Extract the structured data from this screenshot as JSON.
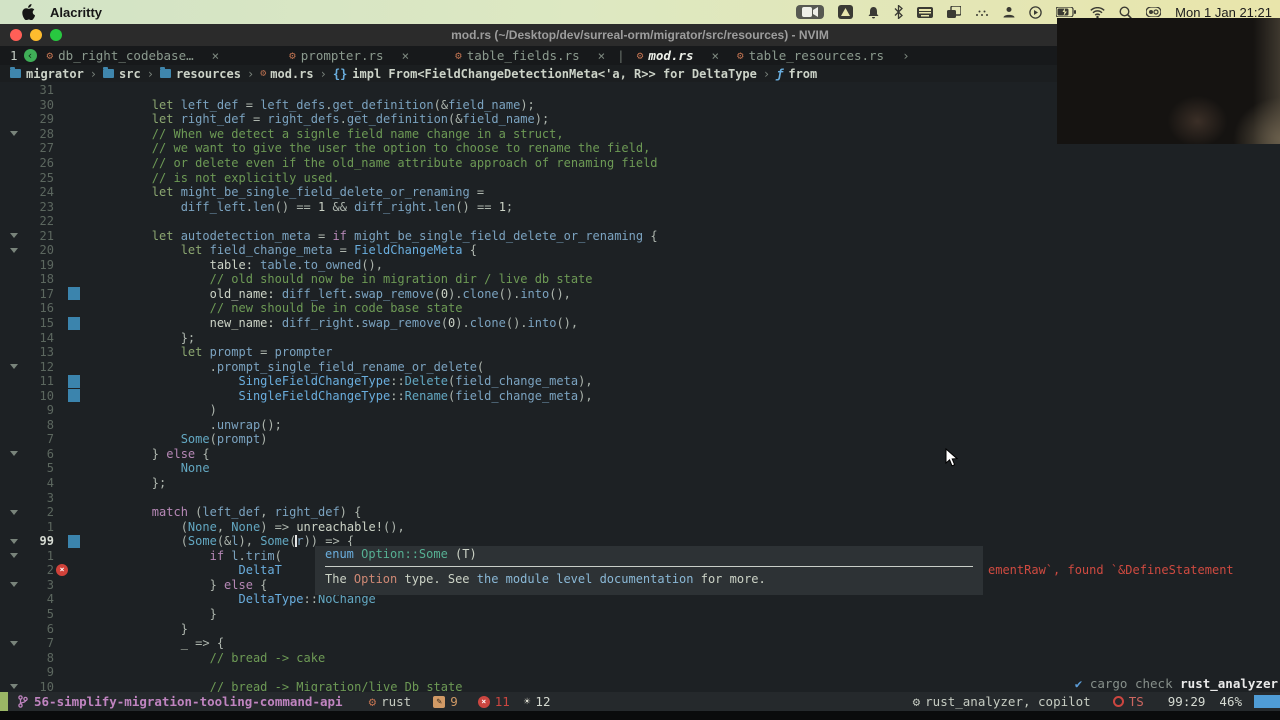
{
  "colors": {
    "accent_blue": "#4f9cd6",
    "error_red": "#cc4640",
    "warn_orange": "#d19a66",
    "branch_purple": "#c084c0",
    "comment_green": "#6d9a55",
    "change_mark_blue": "#3b84ad",
    "mode_green": "#9ab665",
    "traffic_red": "#ff5f57",
    "traffic_yellow": "#febc2e",
    "traffic_green": "#28c840"
  },
  "menubar": {
    "app_name": "Alacritty",
    "clock": "Mon 1 Jan 21:21"
  },
  "window": {
    "title": "mod.rs (~/Desktop/dev/surreal-orm/migrator/src/resources) - NVIM"
  },
  "tabs": {
    "count_label": "1",
    "back_glyph": "‹",
    "items": [
      {
        "label": "db_right_codebase…",
        "close": "×",
        "active": false
      },
      {
        "label": "prompter.rs",
        "close": "×",
        "active": false
      },
      {
        "label": "table_fields.rs",
        "close": "×",
        "active": false
      },
      {
        "label": "mod.rs",
        "close": "×",
        "active": true
      },
      {
        "label": "table_resources.rs",
        "close": "›",
        "active": false
      }
    ]
  },
  "breadcrumb": {
    "separator": "›",
    "segments": [
      {
        "icon": "folder",
        "label": "migrator"
      },
      {
        "icon": "folder",
        "label": "src"
      },
      {
        "icon": "folder",
        "label": "resources"
      },
      {
        "icon": "rust",
        "label": "mod.rs"
      },
      {
        "icon": "braces",
        "label": "impl From<FieldChangeDetectionMeta<'a, R>> for DeltaType"
      },
      {
        "icon": "fn",
        "label": "from"
      }
    ]
  },
  "editor": {
    "lines": [
      {
        "n": "31",
        "tk": []
      },
      {
        "n": "30",
        "tk": [
          [
            "l",
            "        let "
          ],
          [
            "i",
            "left_def "
          ],
          [
            "p",
            "= "
          ],
          [
            "i",
            "left_defs"
          ],
          [
            "p",
            "."
          ],
          [
            "i",
            "get_definition"
          ],
          [
            "p",
            "(&"
          ],
          [
            "i",
            "field_name"
          ],
          [
            "p",
            ");"
          ]
        ]
      },
      {
        "n": "29",
        "tk": [
          [
            "l",
            "        let "
          ],
          [
            "i",
            "right_def "
          ],
          [
            "p",
            "= "
          ],
          [
            "i",
            "right_defs"
          ],
          [
            "p",
            "."
          ],
          [
            "i",
            "get_definition"
          ],
          [
            "p",
            "(&"
          ],
          [
            "i",
            "field_name"
          ],
          [
            "p",
            ");"
          ]
        ]
      },
      {
        "n": "28",
        "fold": 1,
        "tk": [
          [
            "c",
            "        // When we detect a signle field name change in a struct,"
          ]
        ]
      },
      {
        "n": "27",
        "tk": [
          [
            "c",
            "        // we want to give the user the option to choose to rename the field,"
          ]
        ]
      },
      {
        "n": "26",
        "tk": [
          [
            "c",
            "        // or delete even if the old_name attribute approach of renaming field"
          ]
        ]
      },
      {
        "n": "25",
        "tk": [
          [
            "c",
            "        // is not explicitly used."
          ]
        ]
      },
      {
        "n": "24",
        "tk": [
          [
            "l",
            "        let "
          ],
          [
            "i",
            "might_be_single_field_delete_or_renaming "
          ],
          [
            "p",
            "="
          ]
        ]
      },
      {
        "n": "23",
        "tk": [
          [
            "p",
            "            "
          ],
          [
            "i",
            "diff_left"
          ],
          [
            "p",
            "."
          ],
          [
            "i",
            "len"
          ],
          [
            "p",
            "() == "
          ],
          [
            "w",
            "1"
          ],
          [
            "p",
            " && "
          ],
          [
            "i",
            "diff_right"
          ],
          [
            "p",
            "."
          ],
          [
            "i",
            "len"
          ],
          [
            "p",
            "() == "
          ],
          [
            "w",
            "1"
          ],
          [
            "p",
            ";"
          ]
        ]
      },
      {
        "n": "22",
        "tk": []
      },
      {
        "n": "21",
        "fold": 1,
        "tk": [
          [
            "l",
            "        let "
          ],
          [
            "i",
            "autodetection_meta "
          ],
          [
            "p",
            "= "
          ],
          [
            "k",
            "if "
          ],
          [
            "i",
            "might_be_single_field_delete_or_renaming "
          ],
          [
            "p",
            "{"
          ]
        ]
      },
      {
        "n": "20",
        "fold": 1,
        "tk": [
          [
            "l",
            "            let "
          ],
          [
            "i",
            "field_change_meta "
          ],
          [
            "p",
            "= "
          ],
          [
            "t",
            "FieldChangeMeta "
          ],
          [
            "p",
            "{"
          ]
        ]
      },
      {
        "n": "19",
        "tk": [
          [
            "f",
            "                table: "
          ],
          [
            "i",
            "table"
          ],
          [
            "p",
            "."
          ],
          [
            "i",
            "to_owned"
          ],
          [
            "p",
            "(),"
          ]
        ]
      },
      {
        "n": "18",
        "tk": [
          [
            "c",
            "                // old should now be in migration dir / live db state"
          ]
        ]
      },
      {
        "n": "17",
        "sign": "chg",
        "tk": [
          [
            "f",
            "                old_name: "
          ],
          [
            "i",
            "diff_left"
          ],
          [
            "p",
            "."
          ],
          [
            "i",
            "swap_remove"
          ],
          [
            "p",
            "("
          ],
          [
            "w",
            "0"
          ],
          [
            "p",
            ")."
          ],
          [
            "i",
            "clone"
          ],
          [
            "p",
            "()."
          ],
          [
            "i",
            "into"
          ],
          [
            "p",
            "(),"
          ]
        ]
      },
      {
        "n": "16",
        "tk": [
          [
            "c",
            "                // new should be in code base state"
          ]
        ]
      },
      {
        "n": "15",
        "sign": "chg",
        "tk": [
          [
            "f",
            "                new_name: "
          ],
          [
            "i",
            "diff_right"
          ],
          [
            "p",
            "."
          ],
          [
            "i",
            "swap_remove"
          ],
          [
            "p",
            "("
          ],
          [
            "w",
            "0"
          ],
          [
            "p",
            ")."
          ],
          [
            "i",
            "clone"
          ],
          [
            "p",
            "()."
          ],
          [
            "i",
            "into"
          ],
          [
            "p",
            "(),"
          ]
        ]
      },
      {
        "n": "14",
        "tk": [
          [
            "p",
            "            };"
          ]
        ]
      },
      {
        "n": "13",
        "tk": [
          [
            "l",
            "            let "
          ],
          [
            "i",
            "prompt "
          ],
          [
            "p",
            "= "
          ],
          [
            "i",
            "prompter"
          ]
        ]
      },
      {
        "n": "12",
        "fold": 1,
        "tk": [
          [
            "p",
            "                ."
          ],
          [
            "i",
            "prompt_single_field_rename_or_delete"
          ],
          [
            "p",
            "("
          ]
        ]
      },
      {
        "n": "11",
        "sign": "chg",
        "tk": [
          [
            "t",
            "                    SingleFieldChangeType"
          ],
          [
            "p",
            "::"
          ],
          [
            "e",
            "Delete"
          ],
          [
            "p",
            "("
          ],
          [
            "i",
            "field_change_meta"
          ],
          [
            "p",
            "),"
          ]
        ]
      },
      {
        "n": "10",
        "sign": "chg",
        "tk": [
          [
            "t",
            "                    SingleFieldChangeType"
          ],
          [
            "p",
            "::"
          ],
          [
            "e",
            "Rename"
          ],
          [
            "p",
            "("
          ],
          [
            "i",
            "field_change_meta"
          ],
          [
            "p",
            "),"
          ]
        ]
      },
      {
        "n": "9",
        "tk": [
          [
            "p",
            "                )"
          ]
        ]
      },
      {
        "n": "8",
        "tk": [
          [
            "p",
            "                ."
          ],
          [
            "i",
            "unwrap"
          ],
          [
            "p",
            "();"
          ]
        ]
      },
      {
        "n": "7",
        "tk": [
          [
            "e",
            "            Some"
          ],
          [
            "p",
            "("
          ],
          [
            "i",
            "prompt"
          ],
          [
            "p",
            ")"
          ]
        ]
      },
      {
        "n": "6",
        "fold": 1,
        "tk": [
          [
            "p",
            "        } "
          ],
          [
            "k",
            "else "
          ],
          [
            "p",
            "{"
          ]
        ]
      },
      {
        "n": "5",
        "tk": [
          [
            "e",
            "            None"
          ]
        ]
      },
      {
        "n": "4",
        "tk": [
          [
            "p",
            "        };"
          ]
        ]
      },
      {
        "n": "3",
        "tk": []
      },
      {
        "n": "2",
        "fold": 1,
        "tk": [
          [
            "k",
            "        match "
          ],
          [
            "p",
            "("
          ],
          [
            "i",
            "left_def"
          ],
          [
            "p",
            ", "
          ],
          [
            "i",
            "right_def"
          ],
          [
            "p",
            ") {"
          ]
        ]
      },
      {
        "n": "1",
        "tk": [
          [
            "p",
            "            ("
          ],
          [
            "e",
            "None"
          ],
          [
            "p",
            ", "
          ],
          [
            "e",
            "None"
          ],
          [
            "p",
            ") => "
          ],
          [
            "w",
            "unreachable!"
          ],
          [
            "p",
            "(),"
          ]
        ]
      },
      {
        "n": "99",
        "cur": 1,
        "fold": 1,
        "sign": "chg",
        "tk": [
          [
            "p",
            "            ("
          ],
          [
            "e",
            "Some"
          ],
          [
            "p",
            "(&"
          ],
          [
            "i",
            "l"
          ],
          [
            "p",
            "), "
          ],
          [
            "e",
            "Some"
          ],
          [
            "p",
            "("
          ],
          [
            "CUR",
            ""
          ],
          [
            "i",
            "r"
          ],
          [
            "p",
            ")) => {"
          ]
        ]
      },
      {
        "n": "1",
        "fold": 1,
        "tk": [
          [
            "k",
            "                if "
          ],
          [
            "i",
            "l"
          ],
          [
            "p",
            "."
          ],
          [
            "i",
            "trim"
          ],
          [
            "p",
            "("
          ]
        ]
      },
      {
        "n": "2",
        "sign": "err",
        "tk": [
          [
            "t",
            "                    DeltaT"
          ]
        ]
      },
      {
        "n": "3",
        "fold": 1,
        "tk": [
          [
            "p",
            "                } "
          ],
          [
            "k",
            "else "
          ],
          [
            "p",
            "{"
          ]
        ]
      },
      {
        "n": "4",
        "tk": [
          [
            "t",
            "                    DeltaType"
          ],
          [
            "p",
            "::"
          ],
          [
            "e",
            "NoChange"
          ]
        ]
      },
      {
        "n": "5",
        "tk": [
          [
            "p",
            "                }"
          ]
        ]
      },
      {
        "n": "6",
        "tk": [
          [
            "p",
            "            }"
          ]
        ]
      },
      {
        "n": "7",
        "fold": 1,
        "tk": [
          [
            "w",
            "            _ "
          ],
          [
            "p",
            "=> {"
          ]
        ]
      },
      {
        "n": "8",
        "tk": [
          [
            "c",
            "                // bread -> cake"
          ]
        ]
      },
      {
        "n": "9",
        "tk": []
      },
      {
        "n": "10",
        "fold": 1,
        "tk": [
          [
            "c",
            "                // bread -> Migration/live Db state"
          ]
        ]
      }
    ]
  },
  "popup": {
    "title_tokens": [
      [
        "t",
        "enum "
      ],
      [
        "v",
        "Option::Some "
      ],
      [
        "w",
        "(T)"
      ]
    ],
    "body_tokens": [
      [
        "w",
        "The "
      ],
      [
        "sal",
        "Option"
      ],
      [
        "w",
        " type. See "
      ],
      [
        "lb",
        "the module level documentation"
      ],
      [
        "w",
        " for more."
      ]
    ]
  },
  "diagnostic": "ementRaw`, found `&DefineStatement",
  "cargo_note": {
    "check_glyph": "✔",
    "check_label": "cargo check",
    "tool": "rust_analyzer"
  },
  "statusbar": {
    "branch": "56-simplify-migration-tooling-command-api",
    "language": "rust",
    "warnings": "9",
    "errors": "11",
    "hints": "12",
    "lsp": "rust_analyzer, copilot",
    "ts_label": "TS",
    "position": "99:29",
    "scroll": "46%"
  }
}
